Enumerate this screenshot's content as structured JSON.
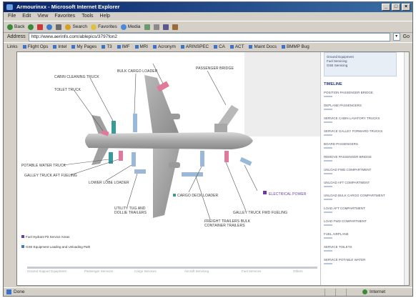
{
  "window": {
    "title": "Armourinxx - Microsoft Internet Explorer",
    "controls": [
      "_",
      "□",
      "×"
    ]
  },
  "menu": [
    "File",
    "Edit",
    "View",
    "Favorites",
    "Tools",
    "Help"
  ],
  "toolbar": {
    "back": "Back",
    "buttons": [
      "Search",
      "Favorites",
      "Media"
    ]
  },
  "address": {
    "label": "Address",
    "value": "http://www.aerinfo.com/ablepics/3797fon2",
    "go": "Go",
    "links_label": "Links"
  },
  "links": [
    "Flight Ops",
    "Intel",
    "My Pages",
    "T3",
    "IMF",
    "MRI",
    "Acronym",
    "ARINSPEC",
    "CA",
    "ACT",
    "Maint Docs",
    "BMMP Bug"
  ],
  "diagram": {
    "labels": [
      {
        "id": "cabin-cleaning-truck",
        "text": "Cabin Cleaning Truck"
      },
      {
        "id": "bulk-cargo-loader",
        "text": "Bulk Cargo Loader"
      },
      {
        "id": "passenger-bridge",
        "text": "Passenger Bridge"
      },
      {
        "id": "toilet-truck",
        "text": "Toilet Truck"
      },
      {
        "id": "potable-water-truck",
        "text": "Potable Water Truck"
      },
      {
        "id": "galley-truck-aft",
        "text": "Galley Truck Aft Fueling"
      },
      {
        "id": "lower-lobe-loader",
        "text": "Lower Lobe Loader"
      },
      {
        "id": "utility-tug",
        "text": "Utility Tug And Dollie Trailers"
      },
      {
        "id": "cargo-deck-loader",
        "text": "Cargo Deck Loader"
      },
      {
        "id": "freight-trailers",
        "text": "Freight Trailers Bulk Container Trailers"
      },
      {
        "id": "galley-truck-fwd",
        "text": "Galley Truck Fwd Fueling"
      },
      {
        "id": "electrical-power",
        "text": "Electrical Power"
      }
    ],
    "legend": [
      "Fuel Hydrant Pit Service Areas",
      "GSE Equipment Loading and Unloading Path"
    ],
    "bottom_labels": [
      "Ground Support Equipment",
      "Passenger Services",
      "Cargo Services",
      "Aircraft Servicing",
      "Fuel Services",
      "Others"
    ]
  },
  "sidepanel": {
    "top_lines": [
      "Ground Equipment",
      "Fuel Servicing",
      "GSE Servicing"
    ],
    "heading": "TIMELINE",
    "items": [
      "Position Passenger Bridge",
      "Deplane Passengers",
      "Service Cabin Lavatory Trucks",
      "Service Galley Forward Trucks",
      "Board Passengers",
      "Remove Passenger Bridge",
      "Unload Fwd Compartment",
      "Unload Aft Compartment",
      "Unload Bulk Cargo Compartment",
      "Load Aft Compartment",
      "Load Fwd Compartment",
      "Fuel Airplane",
      "Service Toilets",
      "Service Potable Water"
    ]
  },
  "status": {
    "text": "Done",
    "zone": "Internet"
  },
  "colors": {
    "title_bar": "#0a246a",
    "pink_gse": "#e07a9a",
    "teal_gse": "#3a9a9a",
    "blue_gse": "#9ab8d8",
    "purple_legend": "#6a3aa6"
  }
}
